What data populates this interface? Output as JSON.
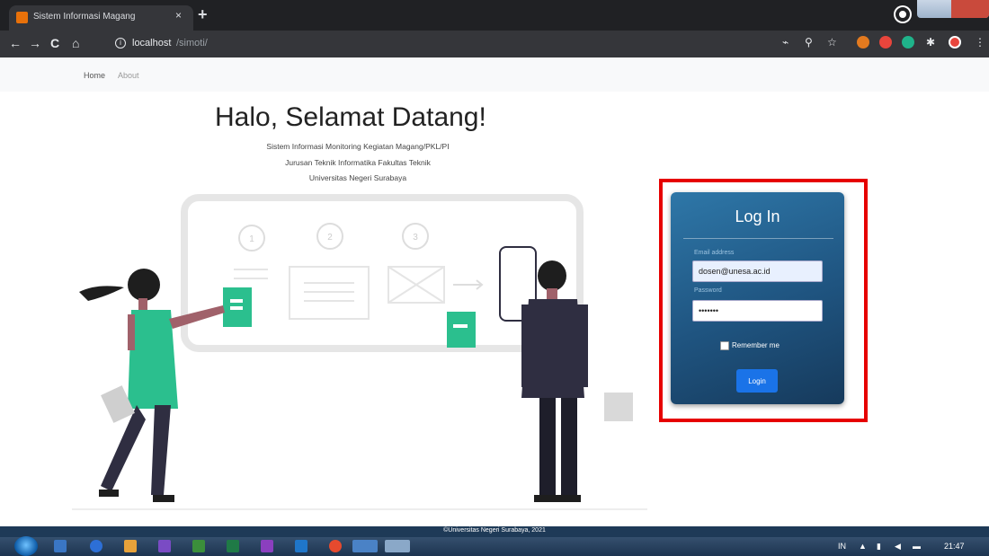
{
  "browser": {
    "tab_title": "Sistem Informasi Magang",
    "tab_close": "×",
    "new_tab": "+",
    "url_host": "localhost",
    "url_path": "/simoti/",
    "back": "←",
    "forward": "→",
    "reload": "C",
    "home": "⌂"
  },
  "nav": {
    "home": "Home",
    "about": "About"
  },
  "hero": {
    "title": "Halo, Selamat Datang!",
    "subtitle_1": "Sistem Informasi Monitoring Kegiatan Magang/PKL/PI",
    "subtitle_2": "Jurusan Teknik Informatika Fakultas Teknik",
    "subtitle_3": "Universitas Negeri Surabaya"
  },
  "login": {
    "title": "Log In",
    "email_label": "Email address",
    "email_value": "dosen@unesa.ac.id",
    "password_label": "Password",
    "password_value": "•••••••",
    "remember_label": "Remember me",
    "login_button": "Login"
  },
  "footer": {
    "text": "©Universitas Negeri Surabaya, 2021"
  },
  "taskbar": {
    "time": "21:47",
    "lang": "IN"
  },
  "colors": {
    "accent_green": "#2bbf8e",
    "card_blue": "#1f5480",
    "highlight_red": "#e60000",
    "button_blue": "#1a73e8"
  }
}
